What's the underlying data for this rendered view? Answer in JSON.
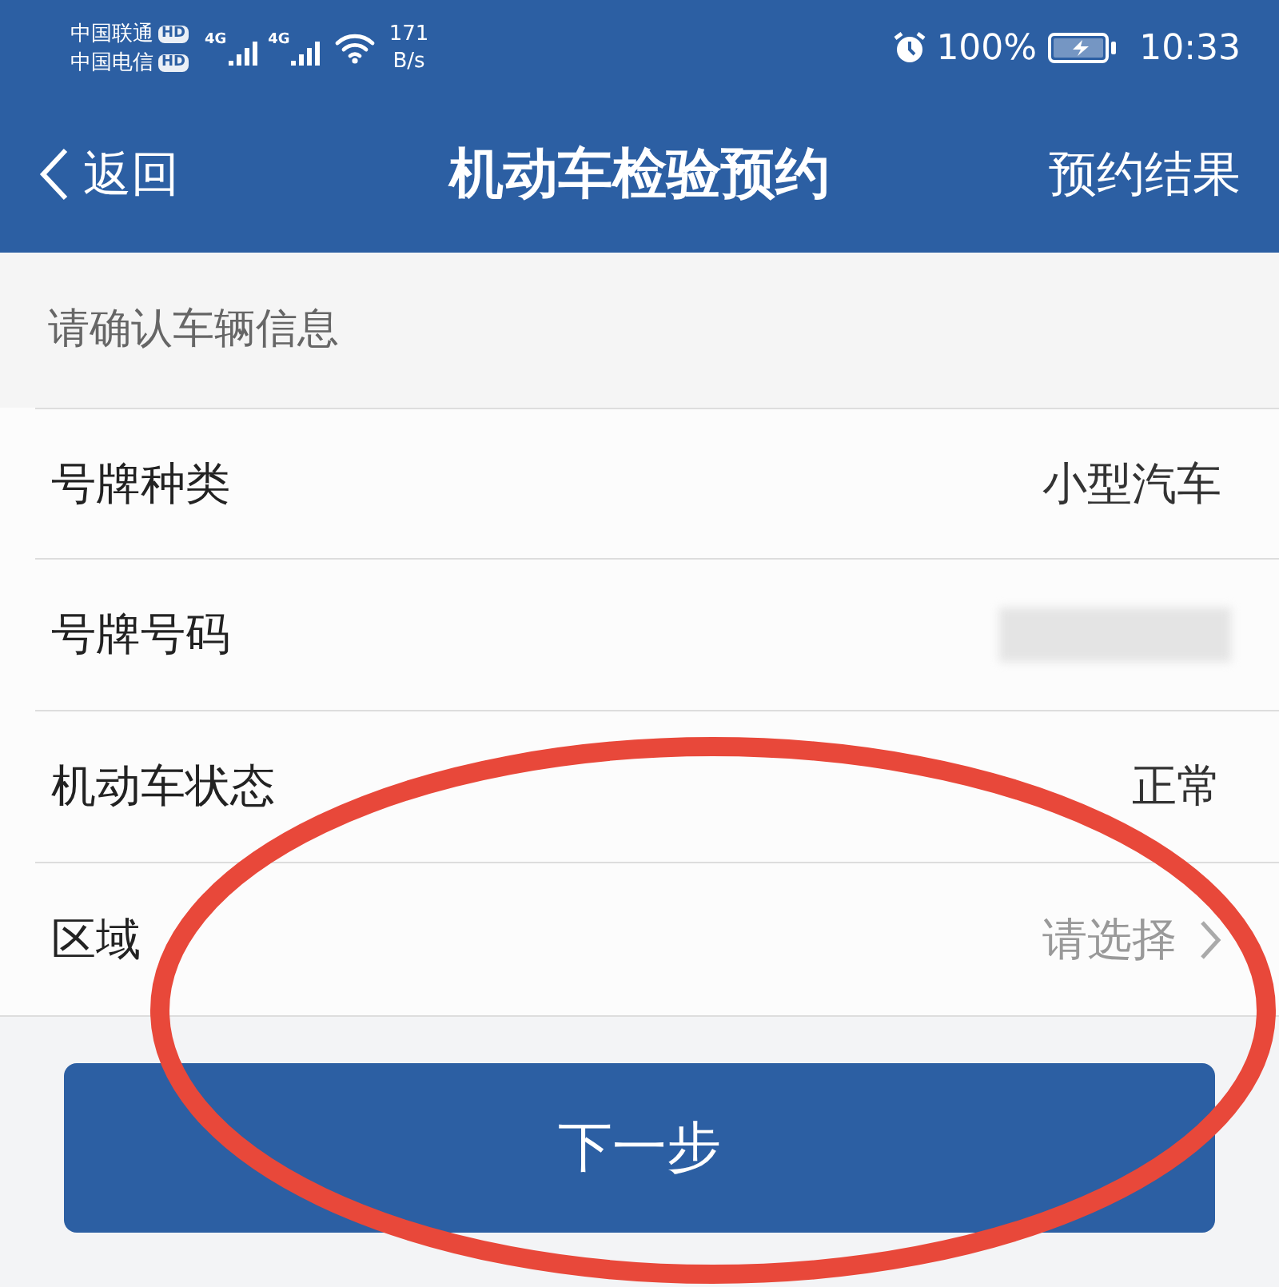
{
  "status_bar": {
    "carriers": [
      {
        "name": "中国联通",
        "badge": "HD"
      },
      {
        "name": "中国电信",
        "badge": "HD"
      }
    ],
    "network_labels": [
      "4G",
      "4G"
    ],
    "speed": [
      "171",
      "B/s"
    ],
    "battery": "100%",
    "time": "10:33"
  },
  "nav": {
    "back": "返回",
    "title": "机动车检验预约",
    "action": "预约结果"
  },
  "section_header": "请确认车辆信息",
  "rows": [
    {
      "kind": "value",
      "label": "号牌种类",
      "value": "小型汽车"
    },
    {
      "kind": "redacted",
      "label": "号牌号码"
    },
    {
      "kind": "value",
      "label": "机动车状态",
      "value": "正常"
    },
    {
      "kind": "select",
      "label": "区域",
      "placeholder": "请选择"
    }
  ],
  "primary_button": "下一步"
}
